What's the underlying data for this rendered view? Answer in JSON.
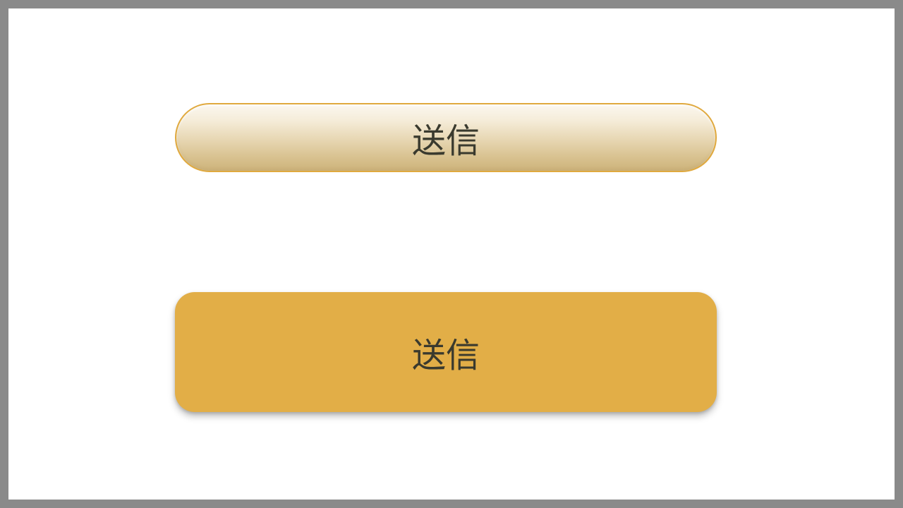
{
  "buttons": {
    "submit_pill_label": "送信",
    "submit_flat_label": "送信"
  },
  "colors": {
    "accent": "#e2ae47",
    "border": "#e0a93e",
    "text": "#3a3a2e",
    "background": "#ffffff",
    "frame": "#8a8a8a"
  }
}
